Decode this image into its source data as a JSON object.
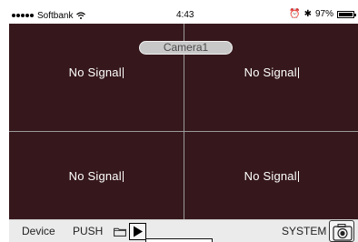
{
  "status_bar": {
    "carrier": "Softbank",
    "time": "4:43",
    "battery": "97%",
    "signal_dots": 5
  },
  "camera": {
    "name": "Camera1"
  },
  "grid": {
    "cells": [
      {
        "label": "No Signal"
      },
      {
        "label": "No Signal"
      },
      {
        "label": "No Signal"
      },
      {
        "label": "No Signal"
      }
    ]
  },
  "toolbar": {
    "device_label": "Device",
    "push_label": "PUSH",
    "system_label": "SYSTEM",
    "icons": [
      "folder-icon",
      "play-icon",
      "camera-icon"
    ]
  },
  "colors": {
    "video_background": "#36181c",
    "toolbar_background": "#ebebeb",
    "grid_divider": "#9a9a9a"
  }
}
